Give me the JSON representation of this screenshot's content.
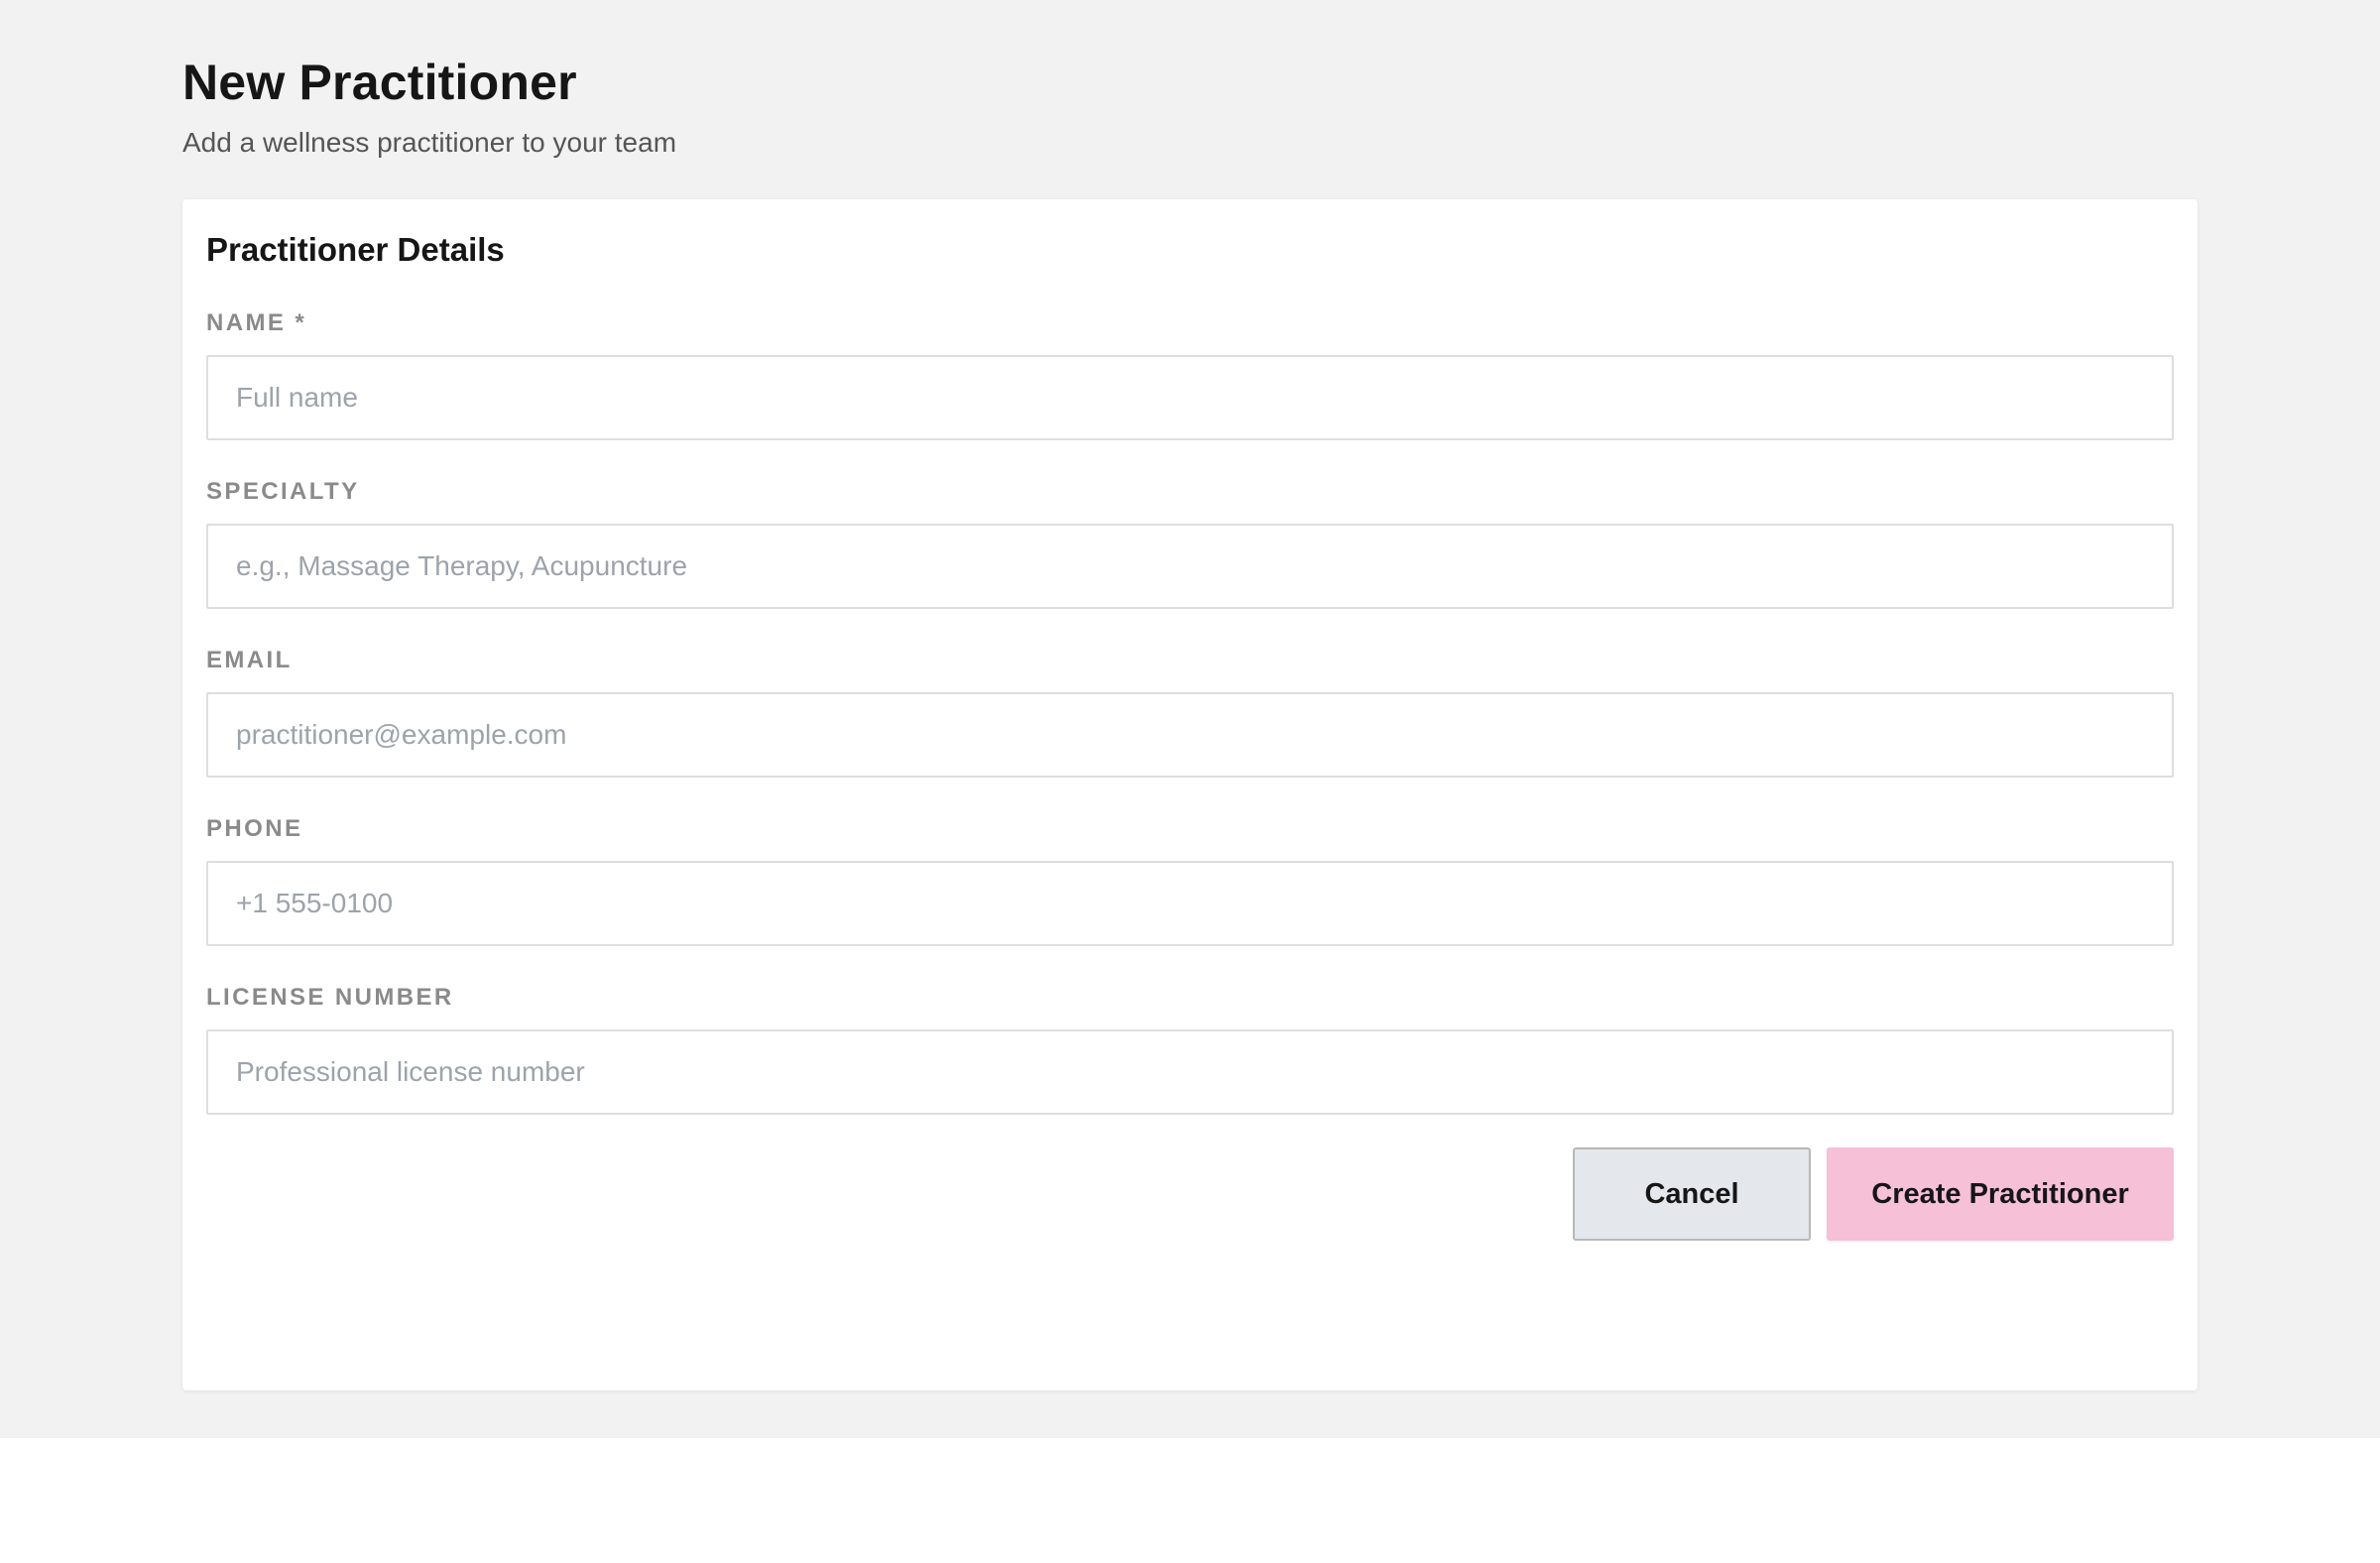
{
  "header": {
    "title": "New Practitioner",
    "subtitle": "Add a wellness practitioner to your team"
  },
  "card": {
    "title": "Practitioner Details"
  },
  "form": {
    "fields": [
      {
        "label": "NAME *",
        "placeholder": "Full name",
        "value": ""
      },
      {
        "label": "SPECIALTY",
        "placeholder": "e.g., Massage Therapy, Acupuncture",
        "value": ""
      },
      {
        "label": "EMAIL",
        "placeholder": "practitioner@example.com",
        "value": ""
      },
      {
        "label": "PHONE",
        "placeholder": "+1 555-0100",
        "value": ""
      },
      {
        "label": "LICENSE NUMBER",
        "placeholder": "Professional license number",
        "value": ""
      }
    ]
  },
  "actions": {
    "cancel_label": "Cancel",
    "create_label": "Create Practitioner"
  },
  "colors": {
    "page_background": "#f2f2f2",
    "card_background": "#ffffff",
    "primary_button": "#f6c0d7",
    "secondary_button": "#e4e7eb",
    "label_text": "#8a8a8a",
    "placeholder_text": "#9da3ab"
  }
}
